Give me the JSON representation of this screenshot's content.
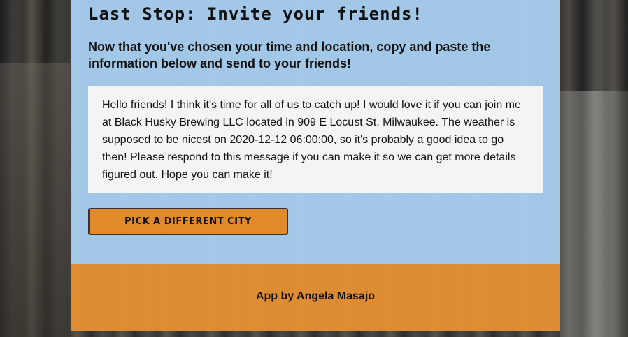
{
  "header": {
    "title": "Last Stop: Invite your friends!"
  },
  "intro": {
    "text": "Now that you've chosen your time and location, copy and paste the information below and send to your friends!"
  },
  "message": {
    "text": "Hello friends! I think it's time for all of us to catch up! I would love it if you can join me at Black Husky Brewing LLC located in 909 E Locust St, Milwaukee. The weather is supposed to be nicest on 2020-12-12 06:00:00, so it's probably a good idea to go then! Please respond to this message if you can make it so we can get more details figured out. Hope you can make it!"
  },
  "actions": {
    "pick_city_label": "PICK A DIFFERENT CITY"
  },
  "footer": {
    "credit": "App by Angela Masajo"
  },
  "colors": {
    "panel": "#aad2f4",
    "accent": "#e08a2c",
    "message_bg": "#f4f4f4"
  }
}
